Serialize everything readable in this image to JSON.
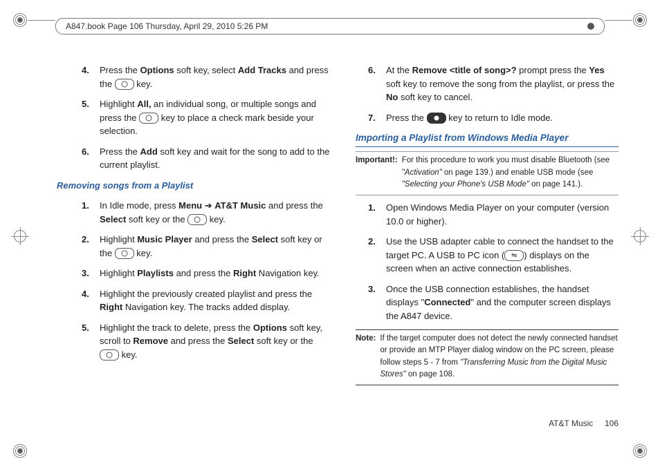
{
  "header": {
    "text": "A847.book  Page 106  Thursday, April 29, 2010  5:26 PM"
  },
  "left": {
    "s4": {
      "n": "4.",
      "a": "Press the ",
      "b": "Options",
      "c": " soft key, select ",
      "d": "Add Tracks",
      "e": " and press the ",
      "f": " key."
    },
    "s5": {
      "n": "5.",
      "a": "Highlight ",
      "b": "All,",
      "c": " an individual song, or multiple songs and press the ",
      "d": " key to place a check mark beside your selection."
    },
    "s6": {
      "n": "6.",
      "a": "Press the ",
      "b": "Add",
      "c": " soft key and wait for the song to add to the current playlist."
    },
    "removing_head": "Removing songs from a Playlist",
    "r1": {
      "n": "1.",
      "a": "In Idle mode, press ",
      "b": "Menu",
      "c": " ➔ ",
      "d": "AT&T Music",
      "e": " and press the ",
      "f": "Select",
      "g": " soft key or the ",
      "h": " key."
    },
    "r2": {
      "n": "2.",
      "a": "Highlight ",
      "b": "Music Player",
      "c": " and press the ",
      "d": "Select",
      "e": " soft key or the ",
      "f": " key."
    },
    "r3": {
      "n": "3.",
      "a": "Highlight ",
      "b": "Playlists",
      "c": " and press the ",
      "d": "Right",
      "e": " Navigation key."
    },
    "r4": {
      "n": "4.",
      "a": "Highlight the previously created playlist and press the ",
      "b": "Right",
      "c": " Navigation key. The tracks added display."
    },
    "r5": {
      "n": "5.",
      "a": "Highlight the track to delete, press the ",
      "b": "Options",
      "c": " soft key, scroll to ",
      "d": "Remove",
      "e": " and press the ",
      "f": "Select",
      "g": " soft key or the ",
      "h": " key."
    }
  },
  "right": {
    "s6": {
      "n": "6.",
      "a": "At the ",
      "b": "Remove <title of song>?",
      "c": " prompt press the ",
      "d": "Yes",
      "e": " soft key to remove the song from the playlist, or press the ",
      "f": "No",
      "g": " soft key to cancel."
    },
    "s7": {
      "n": "7.",
      "a": "Press the ",
      "b": " key to return to Idle mode."
    },
    "import_head": "Importing a Playlist from Windows Media Player",
    "important": {
      "label": "Important!:",
      "a": "For this procedure to work you must disable Bluetooth (see ",
      "b": "\"Activation\"",
      "c": " on page 139.) and enable USB mode (see ",
      "d": "\"Selecting your Phone's USB Mode\"",
      "e": " on page 141.)."
    },
    "i1": {
      "n": "1.",
      "a": "Open Windows Media Player on your computer (version 10.0 or higher)."
    },
    "i2": {
      "n": "2.",
      "a": "Use the USB adapter cable to connect the handset to the target PC. A USB to PC icon (",
      "b": ") displays on the screen when an active connection establishes."
    },
    "i3": {
      "n": "3.",
      "a": "Once the USB connection establishes, the handset displays \"",
      "b": "Connected",
      "c": "\" and the computer screen displays the A847 device."
    },
    "note": {
      "label": "Note:",
      "a": "If the target computer does not detect the newly connected handset or provide an MTP Player dialog window on the PC screen, please follow steps 5 - 7 from ",
      "b": "\"Transferring Music from the Digital Music Stores\"",
      "c": " on page 108."
    }
  },
  "footer": {
    "section": "AT&T Music",
    "page": "106"
  }
}
